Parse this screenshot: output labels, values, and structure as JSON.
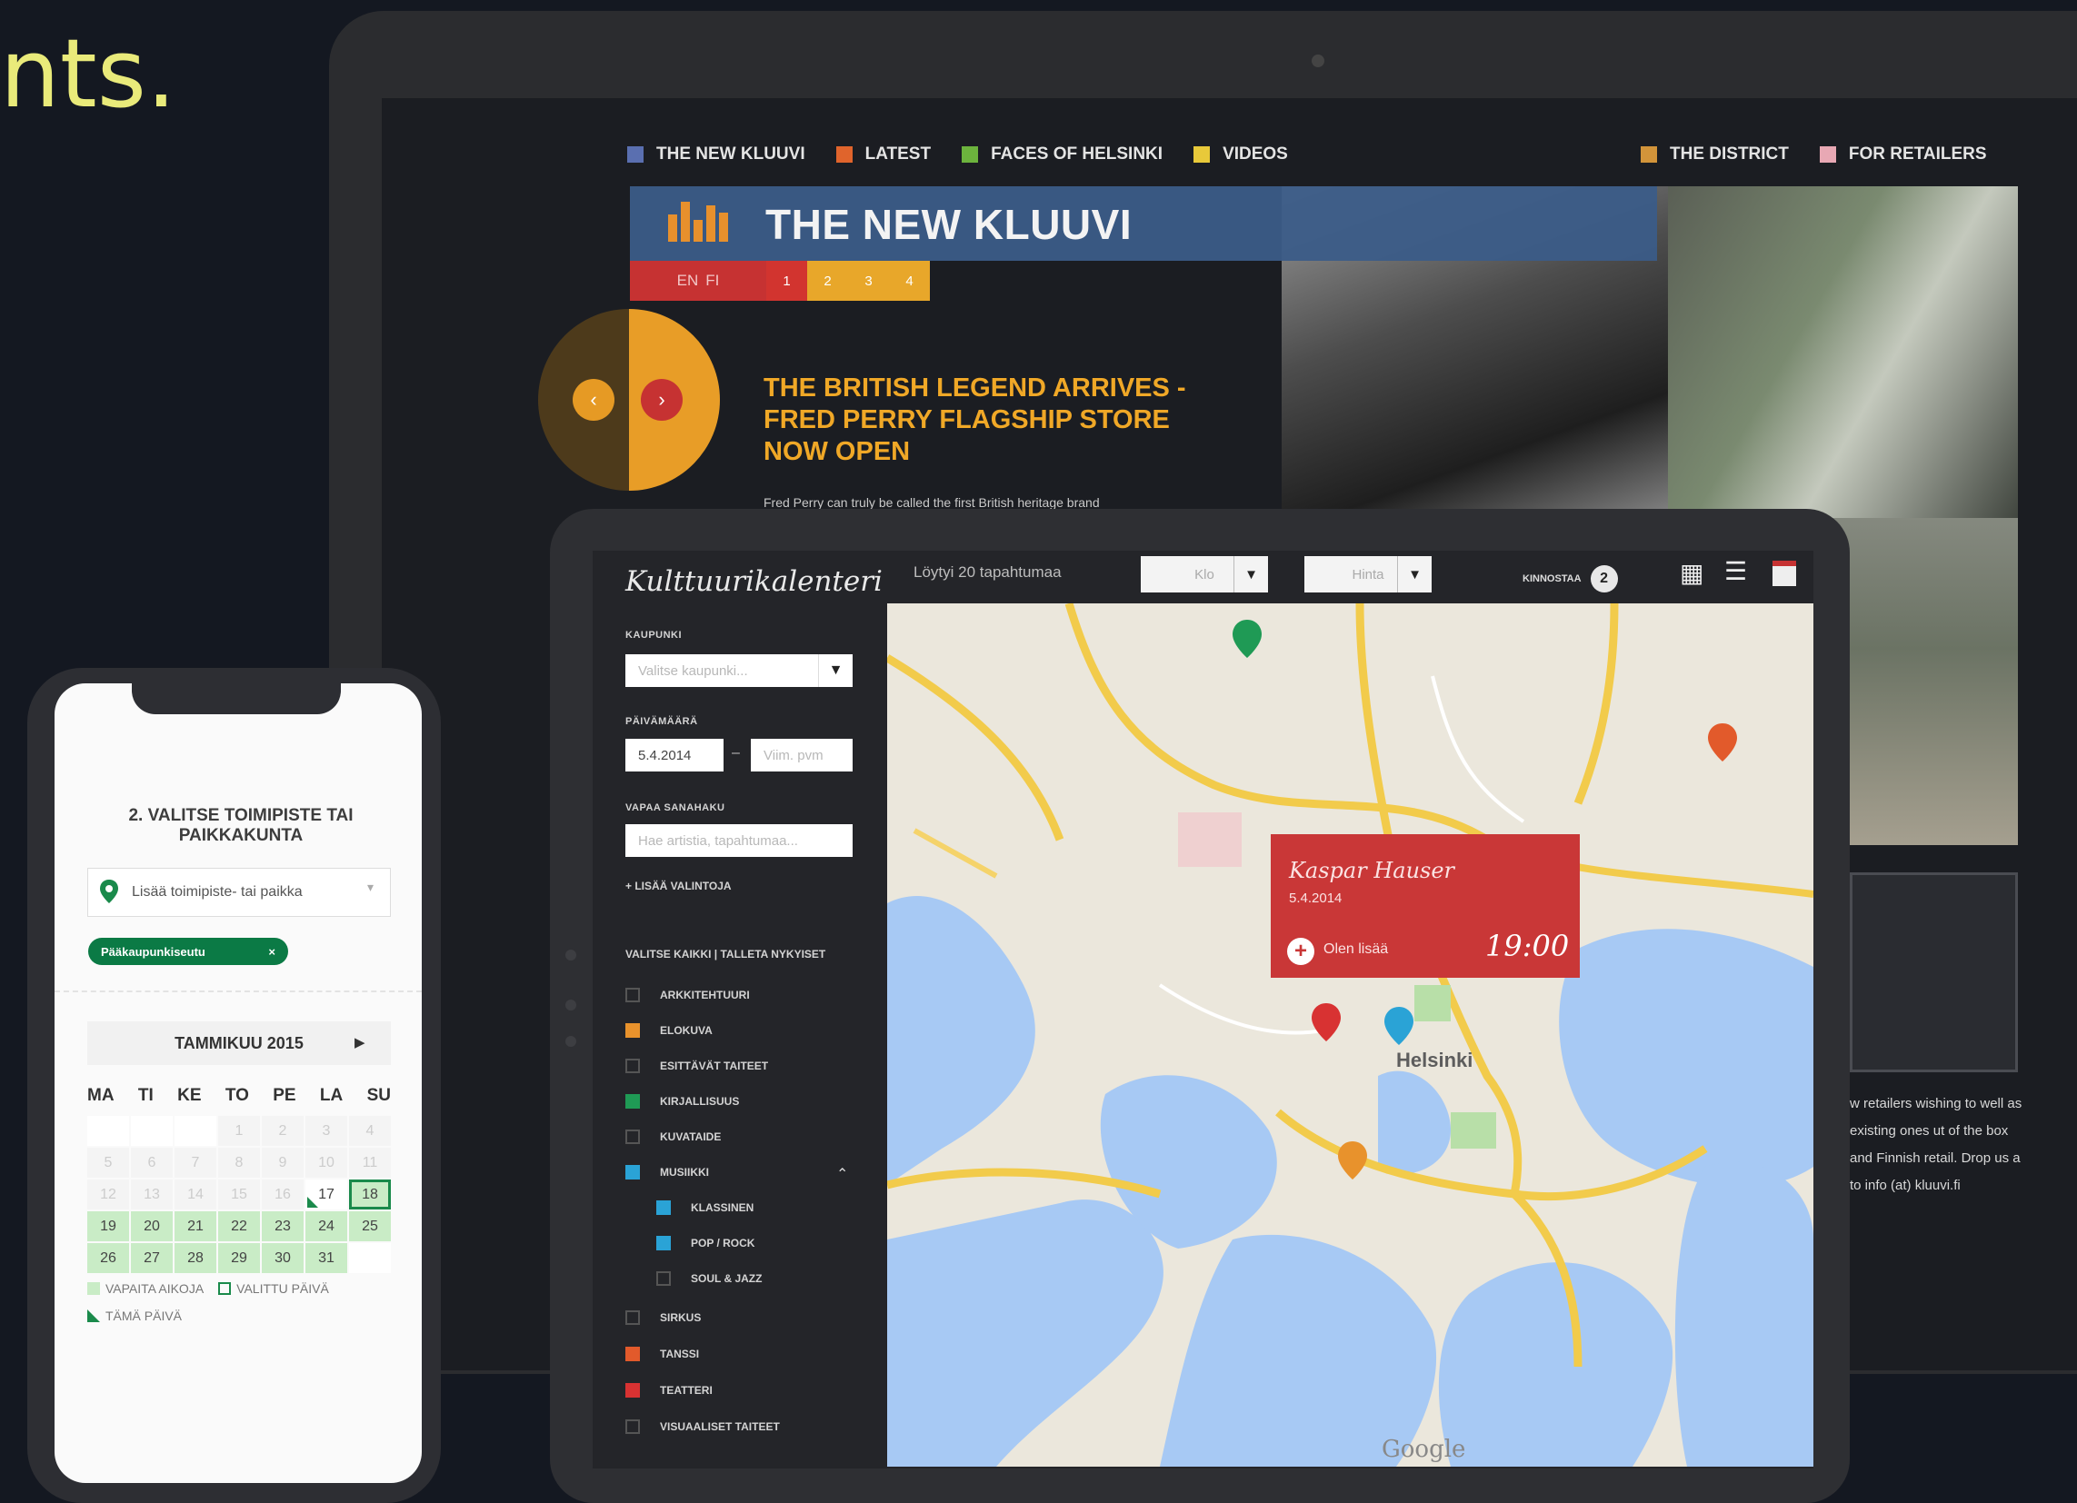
{
  "headline": "nts.",
  "laptop": {
    "nav_left": [
      {
        "label": "THE NEW KLUUVI",
        "color": "#5a6fb0"
      },
      {
        "label": "LATEST",
        "color": "#e0642c"
      },
      {
        "label": "FACES OF HELSINKI",
        "color": "#6cb33d"
      },
      {
        "label": "VIDEOS",
        "color": "#e8c93a"
      }
    ],
    "nav_right": [
      {
        "label": "THE DISTRICT",
        "color": "#d2943a"
      },
      {
        "label": "FOR RETAILERS",
        "color": "#e8a8b4"
      }
    ],
    "brand_title": "THE NEW KLUUVI",
    "lang": {
      "en": "EN",
      "fi": "FI"
    },
    "pages": [
      "1",
      "2",
      "3",
      "4"
    ],
    "article_title": "THE BRITISH LEGEND ARRIVES - FRED PERRY FLAGSHIP STORE NOW OPEN",
    "article_text": "Fred Perry can truly be called the first British heritage brand",
    "side_text": "w retailers wishing to well as existing ones ut of the box and Finnish retail. Drop us a to info (at) kluuvi.fi"
  },
  "tablet": {
    "title": "Kulttuurikalenteri",
    "city_label": "KAUPUNKI",
    "city_placeholder": "Valitse kaupunki...",
    "date_label": "PÄIVÄMÄÄRÄ",
    "date_from": "5.4.2014",
    "date_dash": "–",
    "date_to_placeholder": "Viim. pvm",
    "search_label": "VAPAA SANAHAKU",
    "search_placeholder": "Hae artistia, tapahtumaa...",
    "add_filter": "+ LISÄÄ VALINTOJA",
    "select_all": "VALITSE KAIKKI  |  TALLETA NYKYISET",
    "categories": [
      {
        "label": "ARKKITEHTUURI",
        "color": "",
        "sub": false
      },
      {
        "label": "ELOKUVA",
        "color": "#e8922c",
        "sub": false
      },
      {
        "label": "ESITTÄVÄT TAITEET",
        "color": "",
        "sub": false
      },
      {
        "label": "KIRJALLISUUS",
        "color": "#1f9a55",
        "sub": false
      },
      {
        "label": "KUVATAIDE",
        "color": "",
        "sub": false
      },
      {
        "label": "MUSIIKKI",
        "color": "#2aa3d6",
        "sub": false
      },
      {
        "label": "KLASSINEN",
        "color": "#2aa3d6",
        "sub": true
      },
      {
        "label": "POP / ROCK",
        "color": "#2aa3d6",
        "sub": true
      },
      {
        "label": "SOUL & JAZZ",
        "color": "",
        "sub": true
      },
      {
        "label": "SIRKUS",
        "color": "",
        "sub": false
      },
      {
        "label": "TANSSI",
        "color": "#e25a2b",
        "sub": false
      },
      {
        "label": "TEATTERI",
        "color": "#d83232",
        "sub": false
      },
      {
        "label": "VISUAALISET TAITEET",
        "color": "",
        "sub": false
      }
    ],
    "result_count": "Löytyi 20 tapahtumaa",
    "sort_field": "Klo",
    "price_field": "Hinta",
    "favorites_label": "KINNOSTAA",
    "favorites_count": "2",
    "map": {
      "city": "Helsinki",
      "watermark": "Google",
      "popup_title": "Kaspar Hauser",
      "popup_date": "5.4.2014",
      "popup_link": "Olen lisää",
      "popup_time": "19:00"
    }
  },
  "phone": {
    "step_title": "2. VALITSE TOIMIPISTE TAI PAIKKAKUNTA",
    "search_placeholder": "Lisää toimipiste- tai paikka",
    "chip_label": "Pääkaupunkiseutu",
    "chip_close": "×",
    "month": "TAMMIKUU 2015",
    "weekdays": [
      "MA",
      "TI",
      "KE",
      "TO",
      "PE",
      "LA",
      "SU"
    ],
    "days": [
      {
        "d": "",
        "t": "empty"
      },
      {
        "d": "",
        "t": "empty"
      },
      {
        "d": "",
        "t": "empty"
      },
      {
        "d": "1",
        "t": "past"
      },
      {
        "d": "2",
        "t": "past"
      },
      {
        "d": "3",
        "t": "past"
      },
      {
        "d": "4",
        "t": "past"
      },
      {
        "d": "5",
        "t": "past"
      },
      {
        "d": "6",
        "t": "past"
      },
      {
        "d": "7",
        "t": "past"
      },
      {
        "d": "8",
        "t": "past"
      },
      {
        "d": "9",
        "t": "past"
      },
      {
        "d": "10",
        "t": "past"
      },
      {
        "d": "11",
        "t": "past"
      },
      {
        "d": "12",
        "t": "past"
      },
      {
        "d": "13",
        "t": "past"
      },
      {
        "d": "14",
        "t": "past"
      },
      {
        "d": "15",
        "t": "past"
      },
      {
        "d": "16",
        "t": "past"
      },
      {
        "d": "17",
        "t": "today"
      },
      {
        "d": "18",
        "t": "sel"
      },
      {
        "d": "19",
        "t": "free"
      },
      {
        "d": "20",
        "t": "free"
      },
      {
        "d": "21",
        "t": "free"
      },
      {
        "d": "22",
        "t": "free"
      },
      {
        "d": "23",
        "t": "free"
      },
      {
        "d": "24",
        "t": "free"
      },
      {
        "d": "25",
        "t": "free"
      },
      {
        "d": "26",
        "t": "free"
      },
      {
        "d": "27",
        "t": "free"
      },
      {
        "d": "28",
        "t": "free"
      },
      {
        "d": "29",
        "t": "free"
      },
      {
        "d": "30",
        "t": "free"
      },
      {
        "d": "31",
        "t": "free"
      },
      {
        "d": "",
        "t": "empty"
      }
    ],
    "legend_free": "VAPAITA AIKOJA",
    "legend_selected": "VALITTU PÄIVÄ",
    "legend_today": "TÄMÄ PÄIVÄ"
  }
}
